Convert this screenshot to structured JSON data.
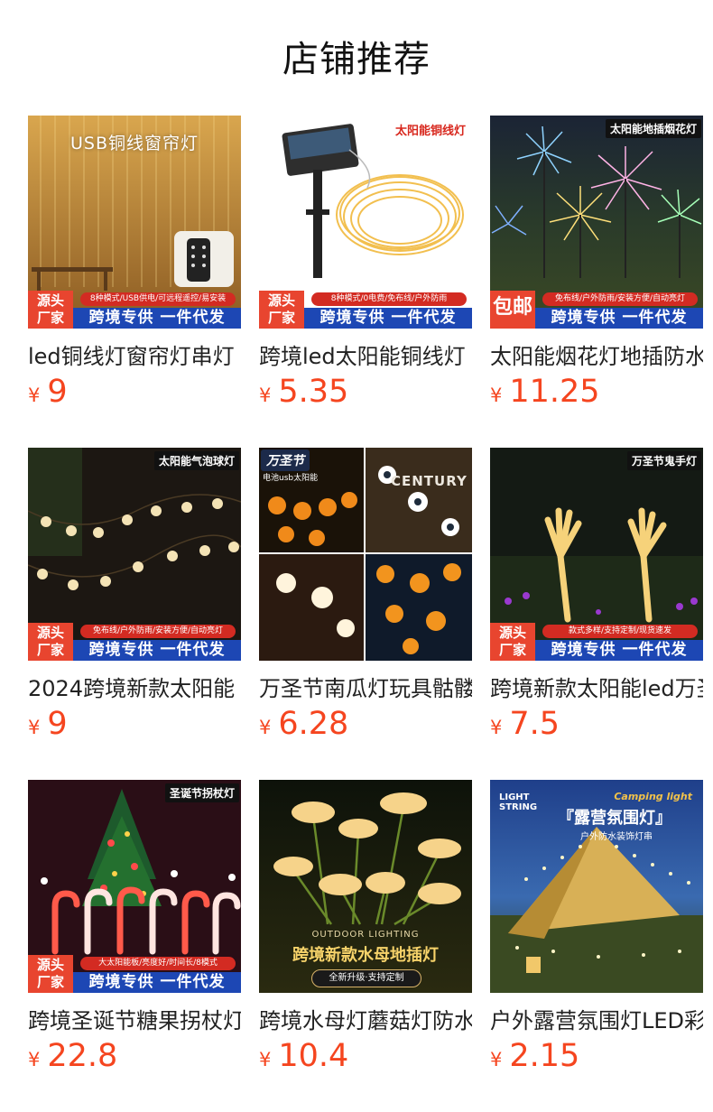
{
  "page": {
    "title": "店铺推荐"
  },
  "products": [
    {
      "name": "led铜线灯窗帘灯串灯",
      "price_symbol": "¥",
      "price": "9",
      "image_top_text": "USB铜线窗帘灯",
      "badge_lines": [
        "源头",
        "厂家"
      ],
      "feature_strip": "8种模式/USB供电/可远程遥控/易安装",
      "banner": "跨境专供 一件代发"
    },
    {
      "name": "跨境led太阳能铜线灯",
      "price_symbol": "¥",
      "price": "5.35",
      "corner_tag": "太阳能铜线灯",
      "badge_lines": [
        "源头",
        "厂家"
      ],
      "feature_strip": "8种模式/0电费/免布线/户外防雨",
      "banner": "跨境专供 一件代发"
    },
    {
      "name": "太阳能烟花灯地插防水",
      "price_symbol": "¥",
      "price": "11.25",
      "corner_tag": "太阳能地插烟花灯",
      "badge_single": "包邮",
      "feature_strip": "免布线/户外防雨/安装方便/自动亮灯",
      "banner": "跨境专供 一件代发"
    },
    {
      "name": "2024跨境新款太阳能",
      "price_symbol": "¥",
      "price": "9",
      "corner_tag": "太阳能气泡球灯",
      "badge_lines": [
        "源头",
        "厂家"
      ],
      "feature_strip": "免布线/户外防雨/安装方便/自动亮灯",
      "banner": "跨境专供 一件代发"
    },
    {
      "name": "万圣节南瓜灯玩具骷髅",
      "price_symbol": "¥",
      "price": "6.28",
      "corner_tag": "万圣节",
      "corner_sub": "电池usb太阳能",
      "corner_sign": "CENTURY"
    },
    {
      "name": "跨境新款太阳能led万圣",
      "price_symbol": "¥",
      "price": "7.5",
      "corner_tag": "万圣节鬼手灯",
      "badge_lines": [
        "源头",
        "厂家"
      ],
      "feature_strip": "款式多样/支持定制/现货速发",
      "banner": "跨境专供 一件代发"
    },
    {
      "name": "跨境圣诞节糖果拐杖灯",
      "price_symbol": "¥",
      "price": "22.8",
      "corner_tag": "圣诞节拐杖灯",
      "badge_lines": [
        "源头",
        "厂家"
      ],
      "feature_strip": "大太阳能板/亮度好/时间长/8模式",
      "banner": "跨境专供 一件代发"
    },
    {
      "name": "跨境水母灯蘑菇灯防水",
      "price_symbol": "¥",
      "price": "10.4",
      "image_en_text": "OUTDOOR LIGHTING",
      "image_title": "跨境新款水母地插灯",
      "image_pill": "全新升级·支持定制"
    },
    {
      "name": "户外露营氛围灯LED彩灯",
      "price_symbol": "¥",
      "price": "2.15",
      "image_en_left": "LIGHT STRING",
      "image_en_right": "Camping light",
      "image_title": "『露营氛围灯』",
      "image_sub": "户外防水装饰灯串"
    }
  ]
}
